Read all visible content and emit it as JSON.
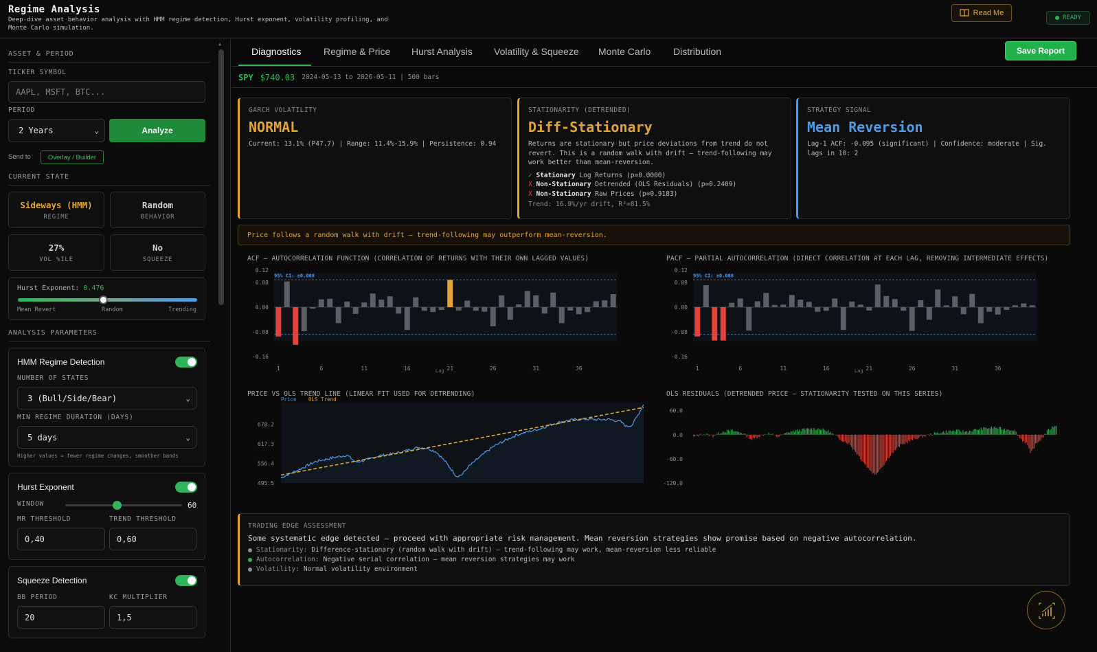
{
  "header": {
    "title": "Regime Analysis",
    "subtitle": "Deep-dive asset behavior analysis with HMM regime detection, Hurst exponent, volatility profiling, and Monte Carlo simulation.",
    "readme_label": "Read Me",
    "status": "READY"
  },
  "sidebar": {
    "asset_section": "ASSET & PERIOD",
    "ticker_label": "TICKER SYMBOL",
    "ticker_placeholder": "AAPL, MSFT, BTC...",
    "period_label": "PERIOD",
    "period_value": "2 Years",
    "analyze_label": "Analyze",
    "send_to_label": "Send to",
    "send_to_chip": "Overlay / Builder",
    "state_section": "CURRENT STATE",
    "stats": [
      {
        "value": "Sideways (HMM)",
        "key": "REGIME",
        "color": "#e4a434"
      },
      {
        "value": "Random",
        "key": "BEHAVIOR",
        "color": "#c8ccd0"
      },
      {
        "value": "27%",
        "key": "VOL %ILE",
        "color": "#c8ccd0"
      },
      {
        "value": "No",
        "key": "SQUEEZE",
        "color": "#c8ccd0"
      }
    ],
    "hurst_label": "Hurst Exponent:",
    "hurst_value": "0.476",
    "hurst_fraction": 0.476,
    "hurst_scale": [
      "Mean Revert",
      "Random",
      "Trending"
    ],
    "params_section": "ANALYSIS PARAMETERS",
    "hmm": {
      "title": "HMM Regime Detection",
      "enabled": true,
      "states_label": "NUMBER OF STATES",
      "states_value": "3 (Bull/Side/Bear)",
      "min_label": "MIN REGIME DURATION (DAYS)",
      "min_value": "5 days",
      "hint": "Higher values = fewer regime changes, smoother bands"
    },
    "hurst": {
      "title": "Hurst Exponent",
      "enabled": true,
      "window_label": "WINDOW",
      "window_value": "60",
      "window_fraction": 0.44,
      "mr_label": "MR THRESHOLD",
      "mr_value": "0,40",
      "trend_label": "TREND THRESHOLD",
      "trend_value": "0,60"
    },
    "squeeze": {
      "title": "Squeeze Detection",
      "enabled": true,
      "bb_label": "BB PERIOD",
      "bb_value": "20",
      "kc_label": "KC MULTIPLIER",
      "kc_value": "1,5"
    }
  },
  "tabs": [
    "Diagnostics",
    "Regime & Price",
    "Hurst Analysis",
    "Volatility & Squeeze",
    "Monte Carlo",
    "Distribution"
  ],
  "save_label": "Save Report",
  "info": {
    "ticker": "SPY",
    "price": "$740.03",
    "range": "2024-05-13 to 2026-05-11 | 500 bars"
  },
  "cards": {
    "garch": {
      "title": "GARCH VOLATILITY",
      "value": "NORMAL",
      "detail": "Current: 13.1% (P47.7) | Range: 11.4%-15.9% | Persistence: 0.94",
      "color": "#e4a434"
    },
    "stationarity": {
      "title": "STATIONARITY (DETRENDED)",
      "value": "Diff-Stationary",
      "detail": "Returns are stationary but price deviations from trend do not revert. This is a random walk with drift — trend-following may work better than mean-reversion.",
      "tests": [
        {
          "mark": "✓",
          "status": "Stationary",
          "text": "Log Returns (p=0.0000)",
          "color": "#2fb45a"
        },
        {
          "mark": "X",
          "status": "Non-Stationary",
          "text": "Detrended (OLS Residuals) (p=0.2409)",
          "color": "#e0443c"
        },
        {
          "mark": "X",
          "status": "Non-Stationary",
          "text": "Raw Prices (p=0.9183)",
          "color": "#e0443c"
        }
      ],
      "trend": "Trend: 16.9%/yr drift, R²=81.5%",
      "color": "#e4a434"
    },
    "signal": {
      "title": "STRATEGY SIGNAL",
      "value": "Mean Reversion",
      "detail": "Lag-1 ACF: -0.095 (significant) | Confidence: moderate | Sig. lags in 10: 2",
      "color": "#4e9be8"
    }
  },
  "banner": "Price follows a random walk with drift — trend-following may outperform mean-reversion.",
  "chart_data": [
    {
      "type": "bar",
      "title": "ACF — AUTOCORRELATION FUNCTION (CORRELATION OF RETURNS WITH THEIR OWN LAGGED VALUES)",
      "xlabel": "Lag",
      "ci_label": "95% CI: ±0.088",
      "ci": 0.088,
      "ylim": [
        -0.16,
        0.12
      ],
      "yticks": [
        "0.08",
        "0.00",
        "-0.08",
        "-0.16"
      ],
      "xticks": [
        "1",
        "6",
        "11",
        "16",
        "21",
        "26",
        "31",
        "36"
      ],
      "x": [
        1,
        2,
        3,
        4,
        5,
        6,
        7,
        8,
        9,
        10,
        11,
        12,
        13,
        14,
        15,
        16,
        17,
        18,
        19,
        20,
        21,
        22,
        23,
        24,
        25,
        26,
        27,
        28,
        29,
        30,
        31,
        32,
        33,
        34,
        35,
        36,
        37,
        38,
        39,
        40
      ],
      "values": [
        -0.095,
        0.083,
        -0.122,
        -0.078,
        -0.005,
        0.025,
        0.027,
        -0.052,
        0.018,
        -0.022,
        0.015,
        0.044,
        0.024,
        0.035,
        -0.021,
        -0.074,
        0.032,
        -0.012,
        -0.016,
        -0.009,
        0.088,
        -0.011,
        0.021,
        -0.012,
        -0.015,
        -0.062,
        0.038,
        -0.041,
        0.009,
        0.052,
        0.038,
        -0.021,
        0.047,
        -0.052,
        -0.011,
        -0.023,
        -0.016,
        0.019,
        0.022,
        0.042
      ]
    },
    {
      "type": "bar",
      "title": "PACF — PARTIAL AUTOCORRELATION (DIRECT CORRELATION AT EACH LAG, REMOVING INTERMEDIATE EFFECTS)",
      "xlabel": "Lag",
      "ci_label": "95% CI: ±0.088",
      "ci": 0.088,
      "ylim": [
        -0.16,
        0.12
      ],
      "yticks": [
        "0.08",
        "0.00",
        "-0.08",
        "-0.16"
      ],
      "xticks": [
        "1",
        "6",
        "11",
        "16",
        "21",
        "26",
        "31",
        "36"
      ],
      "x": [
        1,
        2,
        3,
        4,
        5,
        6,
        7,
        8,
        9,
        10,
        11,
        12,
        13,
        14,
        15,
        16,
        17,
        18,
        19,
        20,
        21,
        22,
        23,
        24,
        25,
        26,
        27,
        28,
        29,
        30,
        31,
        32,
        33,
        34,
        35,
        36,
        37,
        38,
        39,
        40
      ],
      "values": [
        -0.095,
        0.071,
        -0.108,
        -0.108,
        0.014,
        0.028,
        -0.076,
        0.019,
        0.046,
        0.007,
        0.008,
        0.039,
        0.024,
        0.017,
        -0.015,
        -0.012,
        0.028,
        -0.074,
        0.018,
        0.008,
        -0.011,
        0.073,
        0.036,
        0.026,
        -0.012,
        -0.077,
        0.022,
        -0.041,
        0.057,
        0.006,
        0.035,
        -0.023,
        0.043,
        -0.052,
        -0.015,
        -0.024,
        -0.009,
        0.006,
        0.012,
        0.006
      ]
    },
    {
      "type": "line",
      "title": "PRICE VS OLS TREND LINE (LINEAR FIT USED FOR DETRENDING)",
      "series": [
        {
          "name": "Price",
          "color": "#4e9be8"
        },
        {
          "name": "OLS Trend",
          "color": "#e4a434"
        }
      ],
      "yticks": [
        "678.2",
        "617.3",
        "556.4",
        "495.5"
      ],
      "ylim": [
        495.5,
        745
      ],
      "trend": [
        520,
        730
      ],
      "anchors": [
        [
          0,
          512
        ],
        [
          30,
          536
        ],
        [
          60,
          562
        ],
        [
          90,
          574
        ],
        [
          115,
          582
        ],
        [
          130,
          560
        ],
        [
          150,
          568
        ],
        [
          170,
          580
        ],
        [
          195,
          586
        ],
        [
          210,
          592
        ],
        [
          225,
          600
        ],
        [
          240,
          606
        ],
        [
          255,
          603
        ],
        [
          270,
          592
        ],
        [
          285,
          563
        ],
        [
          295,
          540
        ],
        [
          305,
          516
        ],
        [
          315,
          522
        ],
        [
          325,
          545
        ],
        [
          340,
          568
        ],
        [
          355,
          590
        ],
        [
          370,
          610
        ],
        [
          390,
          628
        ],
        [
          410,
          645
        ],
        [
          430,
          655
        ],
        [
          450,
          664
        ],
        [
          470,
          677
        ],
        [
          490,
          687
        ],
        [
          510,
          692
        ],
        [
          530,
          694
        ],
        [
          550,
          692
        ],
        [
          570,
          693
        ],
        [
          590,
          686
        ],
        [
          600,
          671
        ],
        [
          610,
          676
        ],
        [
          620,
          706
        ],
        [
          630,
          740
        ]
      ]
    },
    {
      "type": "bar",
      "title": "OLS RESIDUALS (DETRENDED PRICE — STATIONARITY TESTED ON THIS SERIES)",
      "yticks": [
        "60.0",
        "0.0",
        "-60.0",
        "-120.0"
      ],
      "ylim": [
        -120,
        80
      ],
      "anchors": [
        [
          0,
          -6
        ],
        [
          15,
          2
        ],
        [
          30,
          -3
        ],
        [
          45,
          8
        ],
        [
          60,
          10
        ],
        [
          75,
          5
        ],
        [
          90,
          -12
        ],
        [
          100,
          -4
        ],
        [
          115,
          4
        ],
        [
          130,
          -5
        ],
        [
          150,
          8
        ],
        [
          165,
          12
        ],
        [
          180,
          15
        ],
        [
          195,
          15
        ],
        [
          210,
          8
        ],
        [
          225,
          -10
        ],
        [
          240,
          -22
        ],
        [
          255,
          -52
        ],
        [
          268,
          -80
        ],
        [
          280,
          -100
        ],
        [
          292,
          -78
        ],
        [
          305,
          -48
        ],
        [
          318,
          -28
        ],
        [
          330,
          -18
        ],
        [
          345,
          -8
        ],
        [
          360,
          -2
        ],
        [
          375,
          4
        ],
        [
          390,
          8
        ],
        [
          405,
          10
        ],
        [
          420,
          8
        ],
        [
          435,
          12
        ],
        [
          450,
          16
        ],
        [
          465,
          18
        ],
        [
          480,
          14
        ],
        [
          495,
          12
        ],
        [
          505,
          -10
        ],
        [
          515,
          -22
        ],
        [
          520,
          -48
        ],
        [
          528,
          -25
        ],
        [
          538,
          -8
        ],
        [
          548,
          12
        ],
        [
          560,
          25
        ]
      ]
    }
  ],
  "edge": {
    "title": "TRADING EDGE ASSESSMENT",
    "summary": "Some systematic edge detected — proceed with appropriate risk management. Mean reversion strategies show promise based on negative autocorrelation.",
    "bullets": [
      {
        "label": "Stationarity:",
        "text": "Difference-stationary (random walk with drift) — trend-following may work, mean-reversion less reliable",
        "color": "#8a9095"
      },
      {
        "label": "Autocorrelation:",
        "text": "Negative serial correlation — mean reversion strategies may work",
        "color": "#2fb45a"
      },
      {
        "label": "Volatility:",
        "text": "Normal volatility environment",
        "color": "#8a9095"
      }
    ]
  }
}
